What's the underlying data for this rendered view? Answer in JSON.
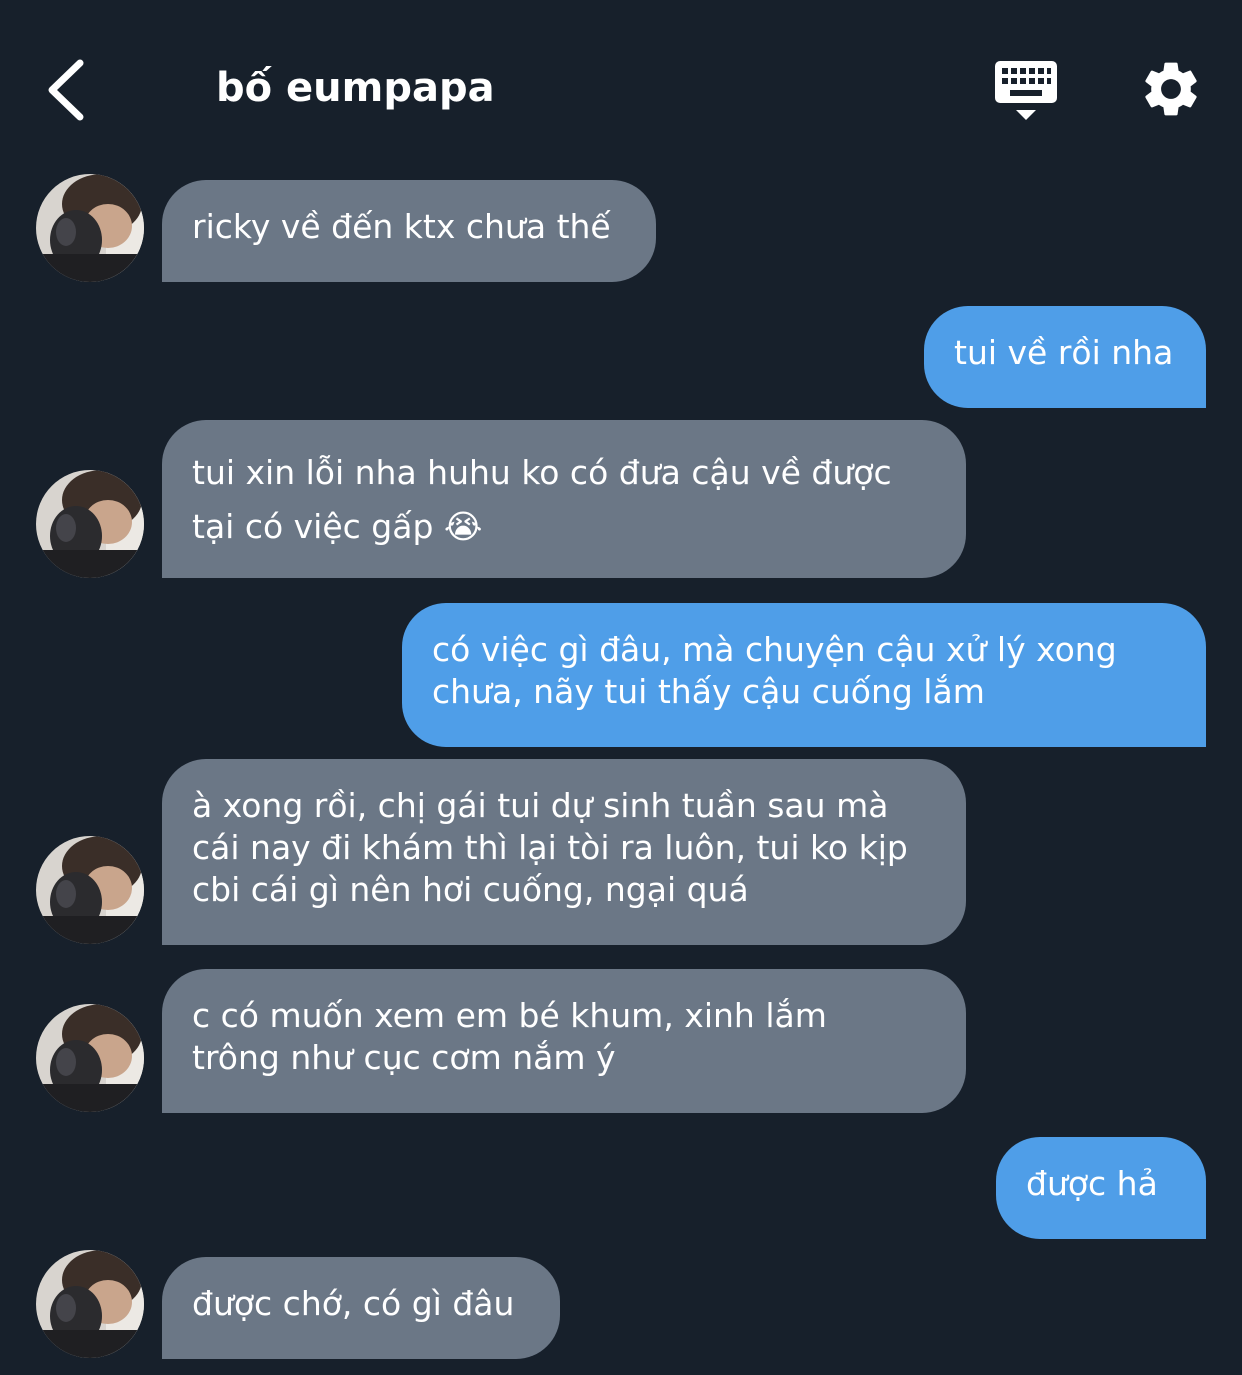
{
  "header": {
    "title": "bố eumpapa",
    "back_icon": "chevron-left-icon",
    "keyboard_icon": "keyboard-hide-icon",
    "settings_icon": "gear-icon"
  },
  "colors": {
    "background": "#17202b",
    "incoming_bubble": "#6b7786",
    "outgoing_bubble": "#4f9ee8",
    "text": "#ffffff"
  },
  "messages": [
    {
      "side": "in",
      "text": "ricky về đến ktx chưa thế"
    },
    {
      "side": "out",
      "text": "tui về rồi nha"
    },
    {
      "side": "in",
      "text": "tui xin lỗi nha huhu ko có đưa cậu về được\ntại có việc gấp 😭"
    },
    {
      "side": "out",
      "text": "có việc gì đâu, mà chuyện cậu xử lý xong\nchưa, nãy tui thấy cậu cuống lắm"
    },
    {
      "side": "in",
      "text": "à xong rồi, chị gái tui dự sinh tuần sau mà\ncái nay đi khám thì lại tòi ra luôn, tui ko kịp\ncbi cái gì nên hơi cuống, ngại quá"
    },
    {
      "side": "in",
      "text": "c có muốn xem em bé khum, xinh lắm\ntrông như cục cơm nắm ý"
    },
    {
      "side": "out",
      "text": "được hả"
    },
    {
      "side": "in",
      "text": "được chớ, có gì đâu"
    }
  ]
}
